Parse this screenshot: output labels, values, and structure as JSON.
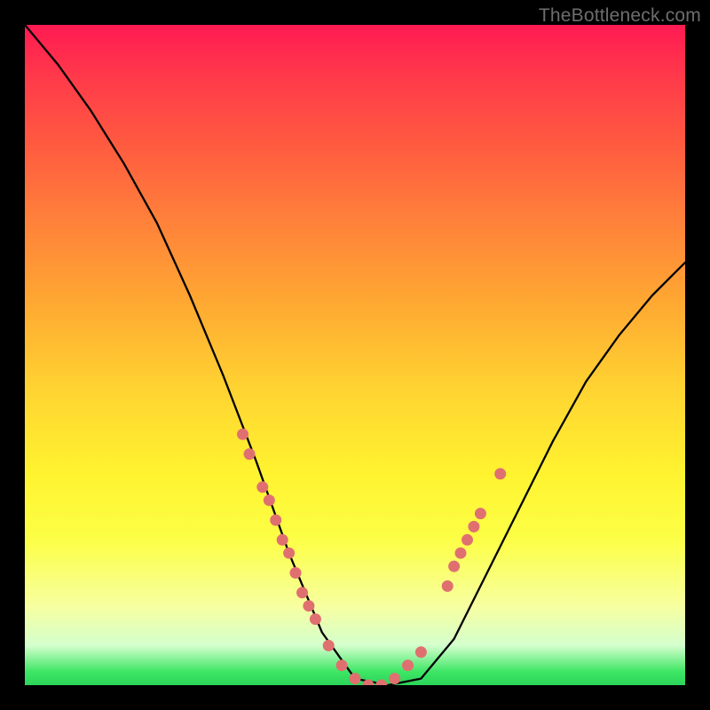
{
  "watermark": "TheBottleneck.com",
  "chart_data": {
    "type": "line",
    "title": "",
    "xlabel": "",
    "ylabel": "",
    "xlim": [
      0,
      100
    ],
    "ylim": [
      0,
      100
    ],
    "series": [
      {
        "name": "bottleneck-curve",
        "x": [
          0,
          5,
          10,
          15,
          20,
          25,
          30,
          35,
          40,
          45,
          50,
          55,
          60,
          65,
          70,
          75,
          80,
          85,
          90,
          95,
          100
        ],
        "values": [
          100,
          94,
          87,
          79,
          70,
          59,
          47,
          34,
          20,
          8,
          1,
          0,
          1,
          7,
          17,
          27,
          37,
          46,
          53,
          59,
          64
        ]
      }
    ],
    "markers": {
      "name": "highlight-points",
      "color": "#e07070",
      "points": [
        {
          "x": 33,
          "y": 38
        },
        {
          "x": 34,
          "y": 35
        },
        {
          "x": 36,
          "y": 30
        },
        {
          "x": 37,
          "y": 28
        },
        {
          "x": 38,
          "y": 25
        },
        {
          "x": 39,
          "y": 22
        },
        {
          "x": 40,
          "y": 20
        },
        {
          "x": 41,
          "y": 17
        },
        {
          "x": 42,
          "y": 14
        },
        {
          "x": 43,
          "y": 12
        },
        {
          "x": 44,
          "y": 10
        },
        {
          "x": 46,
          "y": 6
        },
        {
          "x": 48,
          "y": 3
        },
        {
          "x": 50,
          "y": 1
        },
        {
          "x": 52,
          "y": 0
        },
        {
          "x": 54,
          "y": 0
        },
        {
          "x": 56,
          "y": 1
        },
        {
          "x": 58,
          "y": 3
        },
        {
          "x": 60,
          "y": 5
        },
        {
          "x": 64,
          "y": 15
        },
        {
          "x": 65,
          "y": 18
        },
        {
          "x": 66,
          "y": 20
        },
        {
          "x": 67,
          "y": 22
        },
        {
          "x": 68,
          "y": 24
        },
        {
          "x": 69,
          "y": 26
        },
        {
          "x": 72,
          "y": 32
        }
      ]
    },
    "background_gradient": {
      "top": "#ff1a52",
      "bottom": "#2cd45b"
    }
  }
}
